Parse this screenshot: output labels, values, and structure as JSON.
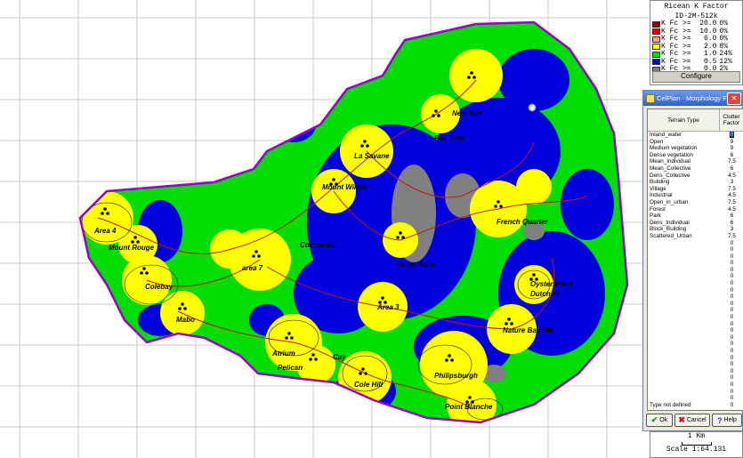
{
  "legend": {
    "title": "Ricean K Factor",
    "subtitle": "ID-2M-512k",
    "rows": [
      {
        "label": "K Fc >=  20.0",
        "pct": "0%",
        "color": "#8b0000"
      },
      {
        "label": "K Fc >=  10.0",
        "pct": "0%",
        "color": "#e00000"
      },
      {
        "label": "K Fc >=   6.0",
        "pct": "0%",
        "color": "#f4a08c"
      },
      {
        "label": "K Fc >=   2.0",
        "pct": "8%",
        "color": "#ffff00"
      },
      {
        "label": "K Fc >=   1.0",
        "pct": "24%",
        "color": "#00dd00"
      },
      {
        "label": "K Fc >=   0.5",
        "pct": "12%",
        "color": "#0000dd"
      },
      {
        "label": "K Fc >=   0.0",
        "pct": "2%",
        "color": "#808080"
      }
    ],
    "configure_label": "Configure"
  },
  "dialog": {
    "title": "CelPlan - Morphology Fact...",
    "close_label": "✕",
    "col_terrain": "Terrain Type",
    "col_clutter": "Clutter Factor",
    "rows": [
      {
        "name": "Inland_water",
        "value": "0"
      },
      {
        "name": "Open",
        "value": "9"
      },
      {
        "name": "Medium vegetation",
        "value": "9"
      },
      {
        "name": "Dense vegetation",
        "value": "6"
      },
      {
        "name": "Mean_Individual",
        "value": "7.5"
      },
      {
        "name": "Mean_Collective",
        "value": "6"
      },
      {
        "name": "Dens_Collective",
        "value": "4.5"
      },
      {
        "name": "Building",
        "value": "3"
      },
      {
        "name": "Village",
        "value": "7.5"
      },
      {
        "name": "Industrial",
        "value": "4.5"
      },
      {
        "name": "Open_in_urban",
        "value": "7.5"
      },
      {
        "name": "Forest",
        "value": "4.5"
      },
      {
        "name": "Park",
        "value": "6"
      },
      {
        "name": "Dens_Individual",
        "value": "6"
      },
      {
        "name": "Block_Building",
        "value": "3"
      },
      {
        "name": "Scattered_Urban",
        "value": "7.5"
      },
      {
        "name": "",
        "value": "0"
      },
      {
        "name": "",
        "value": "0"
      },
      {
        "name": "",
        "value": "0"
      },
      {
        "name": "",
        "value": "0"
      },
      {
        "name": "",
        "value": "0"
      },
      {
        "name": "",
        "value": "0"
      },
      {
        "name": "",
        "value": "0"
      },
      {
        "name": "",
        "value": "0"
      },
      {
        "name": "",
        "value": "0"
      },
      {
        "name": "",
        "value": "0"
      },
      {
        "name": "",
        "value": "0"
      },
      {
        "name": "",
        "value": "0"
      },
      {
        "name": "",
        "value": "0"
      },
      {
        "name": "",
        "value": "0"
      },
      {
        "name": "",
        "value": "0"
      },
      {
        "name": "",
        "value": "0"
      },
      {
        "name": "",
        "value": "0"
      },
      {
        "name": "",
        "value": "0"
      },
      {
        "name": "",
        "value": "0"
      },
      {
        "name": "",
        "value": "0"
      },
      {
        "name": "",
        "value": "0"
      },
      {
        "name": "",
        "value": "0"
      },
      {
        "name": "",
        "value": "0"
      },
      {
        "name": "",
        "value": "0"
      },
      {
        "name": "Type not defined",
        "value": "0"
      }
    ],
    "ok_label": "Ok",
    "cancel_label": "Cancel",
    "help_label": "Help"
  },
  "scale": {
    "distance": "1 Km",
    "ratio": "Scale 1:64.131"
  },
  "map": {
    "cities": [
      "New Site",
      "Pea Tree",
      "La Savane",
      "Mount Wilder",
      "French Quarter",
      "Area 4",
      "Mount Rouge",
      "Concordia",
      "area 7",
      "Union Farm",
      "Colebay",
      "Mabo",
      "Area 3",
      "Oyster Pond",
      "Dutch Ft",
      "Nature Bay Hill",
      "Atrium",
      "Pelican",
      "Cay",
      "Cole Hill",
      "Philipsburgh",
      "Point Blanche"
    ],
    "colors": {
      "background": "#ffffff",
      "grid": "#c8c8c8",
      "boundary": "#9900cc",
      "green": "#00dd00",
      "blue": "#0000dd",
      "yellow": "#ffff00",
      "gray": "#808080"
    }
  }
}
